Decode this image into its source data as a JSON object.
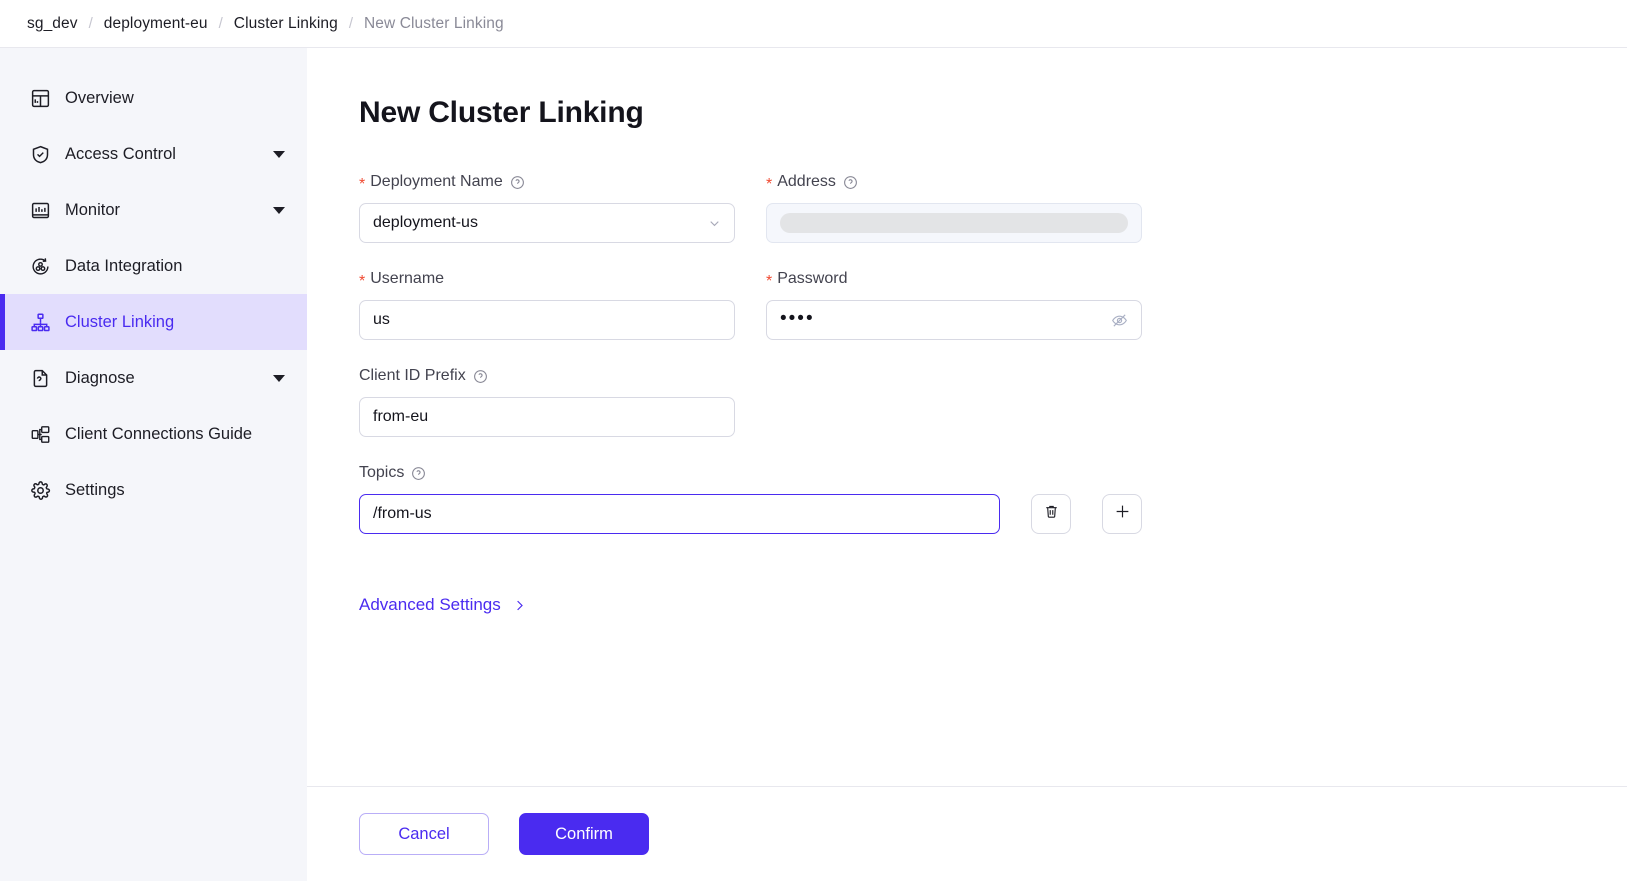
{
  "breadcrumb": {
    "separator": "/",
    "items": [
      {
        "label": "sg_dev",
        "current": false
      },
      {
        "label": "deployment-eu",
        "current": false
      },
      {
        "label": "Cluster Linking",
        "current": false
      },
      {
        "label": "New Cluster Linking",
        "current": true
      }
    ]
  },
  "sidebar": {
    "items": [
      {
        "label": "Overview",
        "icon": "overview-icon",
        "caret": false,
        "active": false
      },
      {
        "label": "Access Control",
        "icon": "shield-check-icon",
        "caret": true,
        "active": false
      },
      {
        "label": "Monitor",
        "icon": "monitor-chart-icon",
        "caret": true,
        "active": false
      },
      {
        "label": "Data Integration",
        "icon": "data-integration-icon",
        "caret": false,
        "active": false
      },
      {
        "label": "Cluster Linking",
        "icon": "cluster-linking-icon",
        "caret": false,
        "active": true
      },
      {
        "label": "Diagnose",
        "icon": "diagnose-file-icon",
        "caret": true,
        "active": false
      },
      {
        "label": "Client Connections Guide",
        "icon": "client-connections-icon",
        "caret": false,
        "active": false
      },
      {
        "label": "Settings",
        "icon": "gear-icon",
        "caret": false,
        "active": false
      }
    ]
  },
  "main": {
    "title": "New Cluster Linking",
    "fields": {
      "deployment_name": {
        "label": "Deployment Name",
        "required": true,
        "has_help": true,
        "value": "deployment-us",
        "control": "select"
      },
      "address": {
        "label": "Address",
        "required": true,
        "has_help": true,
        "value": "",
        "control": "loading"
      },
      "username": {
        "label": "Username",
        "required": true,
        "has_help": false,
        "value": "us",
        "control": "text"
      },
      "password": {
        "label": "Password",
        "required": true,
        "has_help": false,
        "value": "••••",
        "control": "password",
        "masked": true
      },
      "client_id_prefix": {
        "label": "Client ID Prefix",
        "required": false,
        "has_help": true,
        "value": "from-eu",
        "control": "text"
      },
      "topics": {
        "label": "Topics",
        "required": false,
        "has_help": true,
        "value": "/from-us",
        "control": "text",
        "focused": true,
        "delete_title": "Delete topic",
        "add_title": "Add topic"
      }
    },
    "advanced_settings": {
      "label": "Advanced Settings",
      "chevron": "chevron-right-icon"
    }
  },
  "footer": {
    "cancel_label": "Cancel",
    "confirm_label": "Confirm"
  },
  "colors": {
    "accent": "#4a2bf0",
    "accent_soft": "#e2ddfd",
    "required_star": "#f04a32",
    "sidebar_bg": "#f5f6fa",
    "border": "#d8d9e3",
    "text": "#14141c",
    "muted_text": "#8a8a97"
  }
}
